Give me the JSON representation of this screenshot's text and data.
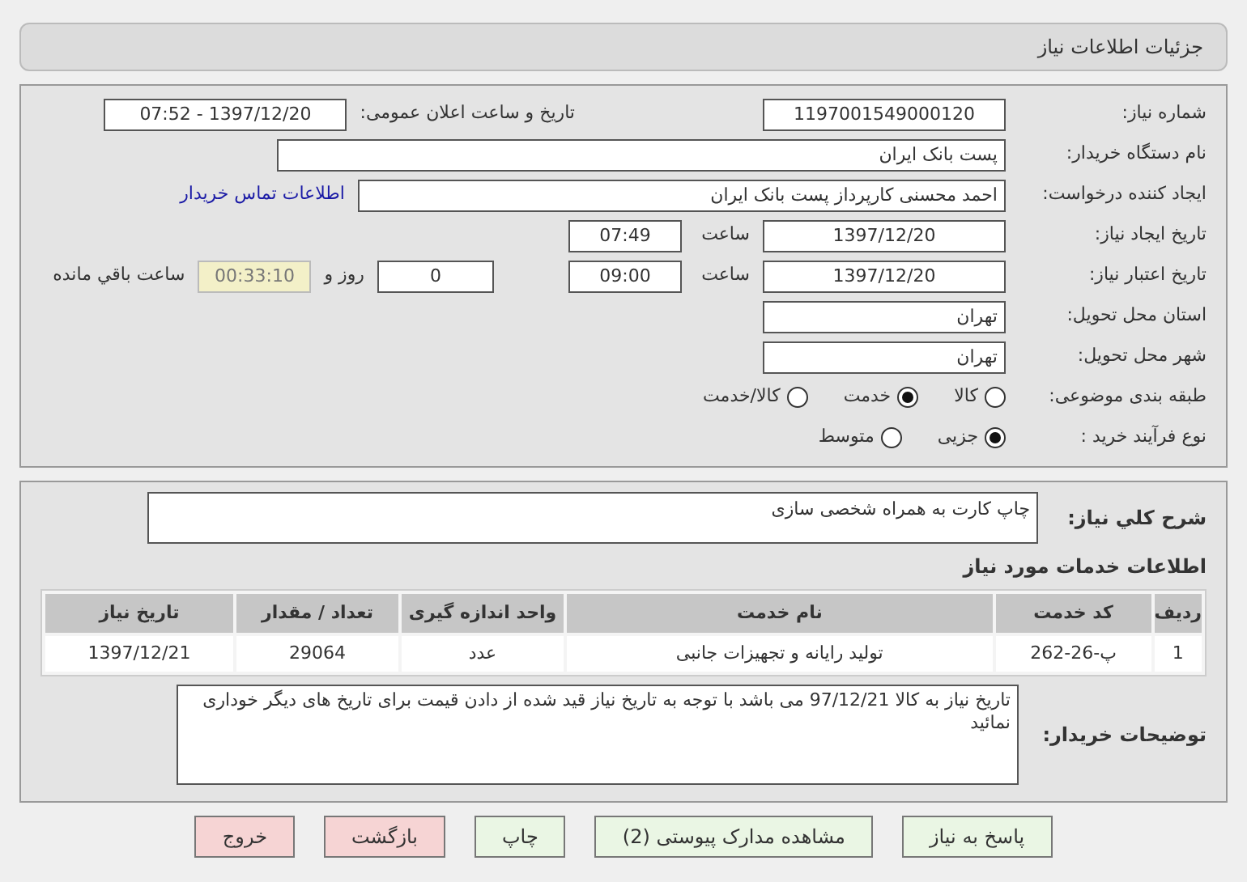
{
  "header": {
    "title": "جزئیات اطلاعات نیاز"
  },
  "details": {
    "need_number": {
      "label": "شماره نیاز:",
      "value": "1197001549000120"
    },
    "announce": {
      "label": "تاریخ و ساعت اعلان عمومی:",
      "value": "1397/12/20 - 07:52"
    },
    "buyer_org": {
      "label": "نام دستگاه خریدار:",
      "value": "پست بانک ایران"
    },
    "requester": {
      "label": "ایجاد کننده درخواست:",
      "value": "احمد  محسنی کارپرداز پست بانک ایران",
      "link": "اطلاعات تماس خریدار"
    },
    "created": {
      "label": "تاریخ ایجاد نیاز:",
      "date": "1397/12/20",
      "time_label": "ساعت",
      "time": "07:49"
    },
    "validity": {
      "label": "تاریخ اعتبار نیاز:",
      "date": "1397/12/20",
      "time_label": "ساعت",
      "time": "09:00",
      "days": "0",
      "days_label": "روز و",
      "remaining": "00:33:10",
      "remaining_label": "ساعت باقي مانده"
    },
    "province": {
      "label": "استان محل تحویل:",
      "value": "تهران"
    },
    "city": {
      "label": "شهر محل تحویل:",
      "value": "تهران"
    },
    "category": {
      "label": "طبقه بندی موضوعی:",
      "options": [
        {
          "label": "کالا",
          "selected": false
        },
        {
          "label": "خدمت",
          "selected": true
        },
        {
          "label": "کالا/خدمت",
          "selected": false
        }
      ]
    },
    "purchase_type": {
      "label": "نوع فرآیند خرید :",
      "options": [
        {
          "label": "جزیی",
          "selected": true
        },
        {
          "label": "متوسط",
          "selected": false
        }
      ]
    }
  },
  "summary": {
    "label": "شرح کلي نیاز:",
    "value": "چاپ کارت به همراه شخصی سازی"
  },
  "services": {
    "title": "اطلاعات خدمات مورد نیاز",
    "columns": [
      "ردیف",
      "کد خدمت",
      "نام خدمت",
      "واحد اندازه گیری",
      "تعداد / مقدار",
      "تاریخ نیاز"
    ],
    "rows": [
      [
        "1",
        "پ-26-262",
        "تولید رایانه و تجهیزات جانبی",
        "عدد",
        "29064",
        "1397/12/21"
      ]
    ]
  },
  "buyer_notes": {
    "label": "توضیحات خریدار:",
    "value": "تاریخ نیاز به کالا 97/12/21 می باشد با توجه به تاریخ نیاز قید شده از دادن قیمت برای تاریخ های دیگر خوداری نمائید"
  },
  "buttons": [
    {
      "label": "پاسخ به نیاز",
      "kind": "action"
    },
    {
      "label": "مشاهده مدارک پیوستی (2)",
      "kind": "action"
    },
    {
      "label": "چاپ",
      "kind": "action"
    },
    {
      "label": "بازگشت",
      "kind": "exit"
    },
    {
      "label": "خروج",
      "kind": "exit"
    }
  ]
}
